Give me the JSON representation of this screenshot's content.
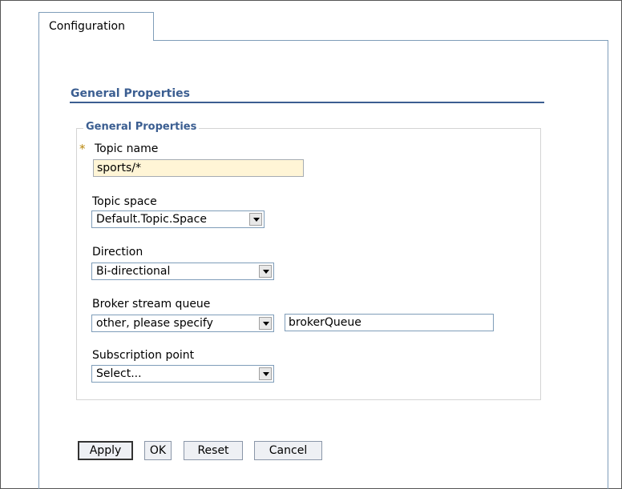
{
  "tabs": [
    {
      "label": "Configuration"
    }
  ],
  "section": {
    "title": "General Properties"
  },
  "fieldset": {
    "legend": "General Properties"
  },
  "fields": {
    "topic_name": {
      "label": "Topic name",
      "value": "sports/*",
      "required": true
    },
    "topic_space": {
      "label": "Topic space",
      "selected": "Default.Topic.Space"
    },
    "direction": {
      "label": "Direction",
      "selected": "Bi-directional"
    },
    "broker_stream_queue": {
      "label": "Broker stream queue",
      "selected": "other, please specify",
      "other_value": "brokerQueue"
    },
    "subscription_point": {
      "label": "Subscription point",
      "selected": "Select..."
    }
  },
  "buttons": {
    "apply": "Apply",
    "ok": "OK",
    "reset": "Reset",
    "cancel": "Cancel"
  },
  "colors": {
    "section_title": "#3b5e91",
    "required_marker": "#b8860b",
    "input_highlight": "#fff5d6"
  },
  "required_marker": "*"
}
